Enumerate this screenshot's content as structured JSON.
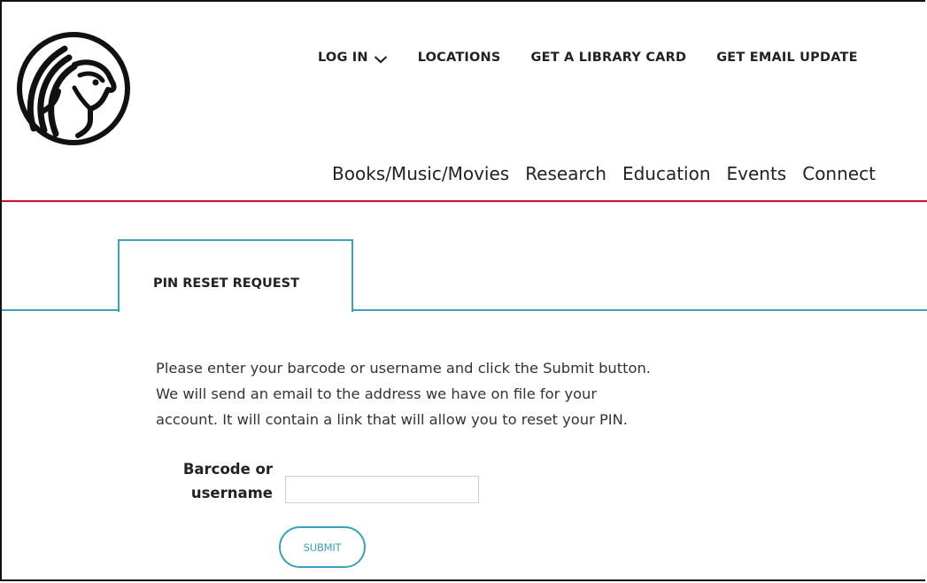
{
  "header": {
    "logo_icon": "lion-logo-icon",
    "utility_nav": {
      "login": "LOG IN",
      "login_icon": "chevron-down-icon",
      "locations": "LOCATIONS",
      "library_card": "GET A LIBRARY CARD",
      "email_updates": "GET EMAIL UPDATE"
    },
    "main_nav": {
      "books": "Books/Music/Movies",
      "research": "Research",
      "education": "Education",
      "events": "Events",
      "connect": "Connect"
    }
  },
  "tab": {
    "label": "PIN RESET REQUEST"
  },
  "instructions": {
    "line1": "Please enter your barcode or username and click the Submit button.",
    "line2": "We will send an email to the address we have on file for your",
    "line3": "account. It will contain a link that will allow you to reset your PIN."
  },
  "form": {
    "label_line1": "Barcode or",
    "label_line2": "username",
    "input_value": "",
    "submit_label": "SUBMIT"
  },
  "colors": {
    "accent": "#3aa3b8",
    "rule_red": "#c8102e"
  }
}
